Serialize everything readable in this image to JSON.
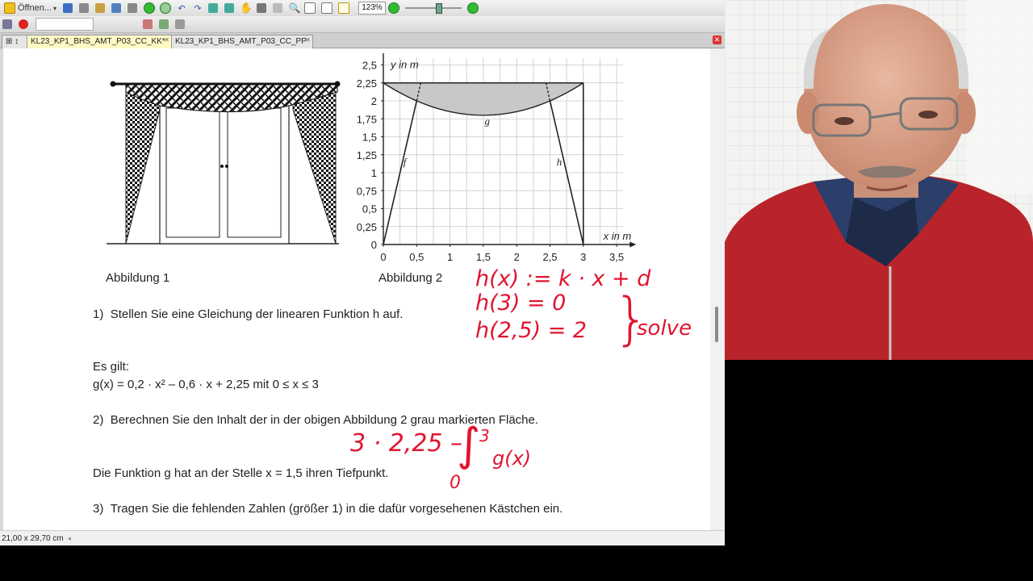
{
  "toolbar": {
    "open_label": "Öffnen...",
    "zoom_value": "123%"
  },
  "tabs": [
    {
      "label": "KL23_KP1_BHS_AMT_P03_CC_KK*"
    },
    {
      "label": "KL23_KP1_BHS_AMT_P03_CC_PP"
    }
  ],
  "status": {
    "page_size": "21,00 x 29,70 cm"
  },
  "figure1": {
    "caption": "Abbildung 1"
  },
  "figure2": {
    "caption": "Abbildung 2",
    "y_axis_label": "y in m",
    "x_axis_label": "x in m",
    "y_ticks": [
      "0",
      "0,25",
      "0,5",
      "0,75",
      "1",
      "1,25",
      "1,5",
      "1,75",
      "2",
      "2,25",
      "2,5"
    ],
    "x_ticks": [
      "0",
      "0,5",
      "1",
      "1,5",
      "2",
      "2,5",
      "3",
      "3,5"
    ],
    "label_f": "f",
    "label_h": "h",
    "label_g": "g"
  },
  "chart_data": {
    "type": "line",
    "xlabel": "x in m",
    "ylabel": "y in m",
    "xlim": [
      0,
      3.5
    ],
    "ylim": [
      0,
      2.5
    ],
    "series": [
      {
        "name": "f",
        "x": [
          0,
          0.5
        ],
        "y": [
          0,
          2
        ]
      },
      {
        "name": "h",
        "x": [
          2.5,
          3
        ],
        "y": [
          2,
          0
        ]
      },
      {
        "name": "g",
        "x": [
          0,
          0.5,
          1,
          1.5,
          2,
          2.5,
          3
        ],
        "y": [
          2.25,
          2.0,
          1.85,
          1.8,
          1.85,
          2.0,
          2.25
        ]
      }
    ],
    "top_line_y": 2.25,
    "shaded_region": "between y = 2,25 and g for 0 ≤ x ≤ 3",
    "grid": true
  },
  "content": {
    "q1_num": "1)",
    "q1_text": "Stellen Sie eine Gleichung der linearen Funktion h auf.",
    "es_gilt": "Es gilt:",
    "formula": "g(x) = 0,2 · x² – 0,6 · x + 2,25    mit    0 ≤ x ≤ 3",
    "q2_num": "2)",
    "q2_text": "Berechnen Sie den Inhalt der in der obigen Abbildung 2 grau markierten Fläche.",
    "tiefpunkt": "Die Funktion g hat an der Stelle  x = 1,5  ihren Tiefpunkt.",
    "q3_num": "3)",
    "q3_text": "Tragen Sie die fehlenden Zahlen (größer 1) in die dafür vorgesehenen Kästchen ein."
  },
  "handwriting": {
    "line1": "h(x) := k · x + d",
    "line2": "h(3) = 0",
    "line3": "h(2,5) = 2",
    "solve": "solve",
    "integral_expr": "3 · 2,25 –",
    "integral_upper": "3",
    "integral_lower": "0",
    "integrand": "g(x)"
  },
  "colors": {
    "ink": "#e01530",
    "active_tab": "#fff9c4",
    "shaded_area": "#c8c8c8"
  }
}
